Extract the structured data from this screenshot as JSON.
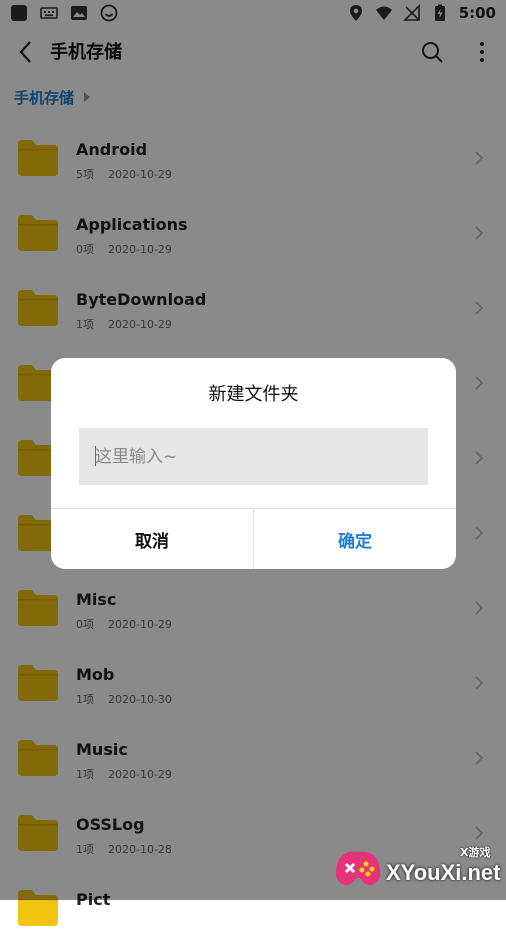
{
  "status_bar": {
    "time": "5:00"
  },
  "app_bar": {
    "title": "手机存储"
  },
  "breadcrumb": {
    "label": "手机存储"
  },
  "files": [
    {
      "name": "Android",
      "count": "5项",
      "date": "2020-10-29"
    },
    {
      "name": "Applications",
      "count": "0项",
      "date": "2020-10-29"
    },
    {
      "name": "ByteDownload",
      "count": "1项",
      "date": "2020-10-29"
    },
    {
      "name": "",
      "count": "",
      "date": ""
    },
    {
      "name": "",
      "count": "",
      "date": ""
    },
    {
      "name": "",
      "count": "",
      "date": ""
    },
    {
      "name": "Misc",
      "count": "0项",
      "date": "2020-10-29"
    },
    {
      "name": "Mob",
      "count": "1项",
      "date": "2020-10-30"
    },
    {
      "name": "Music",
      "count": "1项",
      "date": "2020-10-29"
    },
    {
      "name": "OSSLog",
      "count": "1项",
      "date": "2020-10-28"
    },
    {
      "name": "Pict",
      "count": "",
      "date": ""
    }
  ],
  "dialog": {
    "title": "新建文件夹",
    "input_placeholder": "这里输入~",
    "cancel_label": "取消",
    "ok_label": "确定"
  },
  "watermark": {
    "text": "XYouXi.net",
    "small": "X游戏"
  },
  "colors": {
    "accent": "#1f7ed1",
    "folder": "#f1c40f"
  }
}
